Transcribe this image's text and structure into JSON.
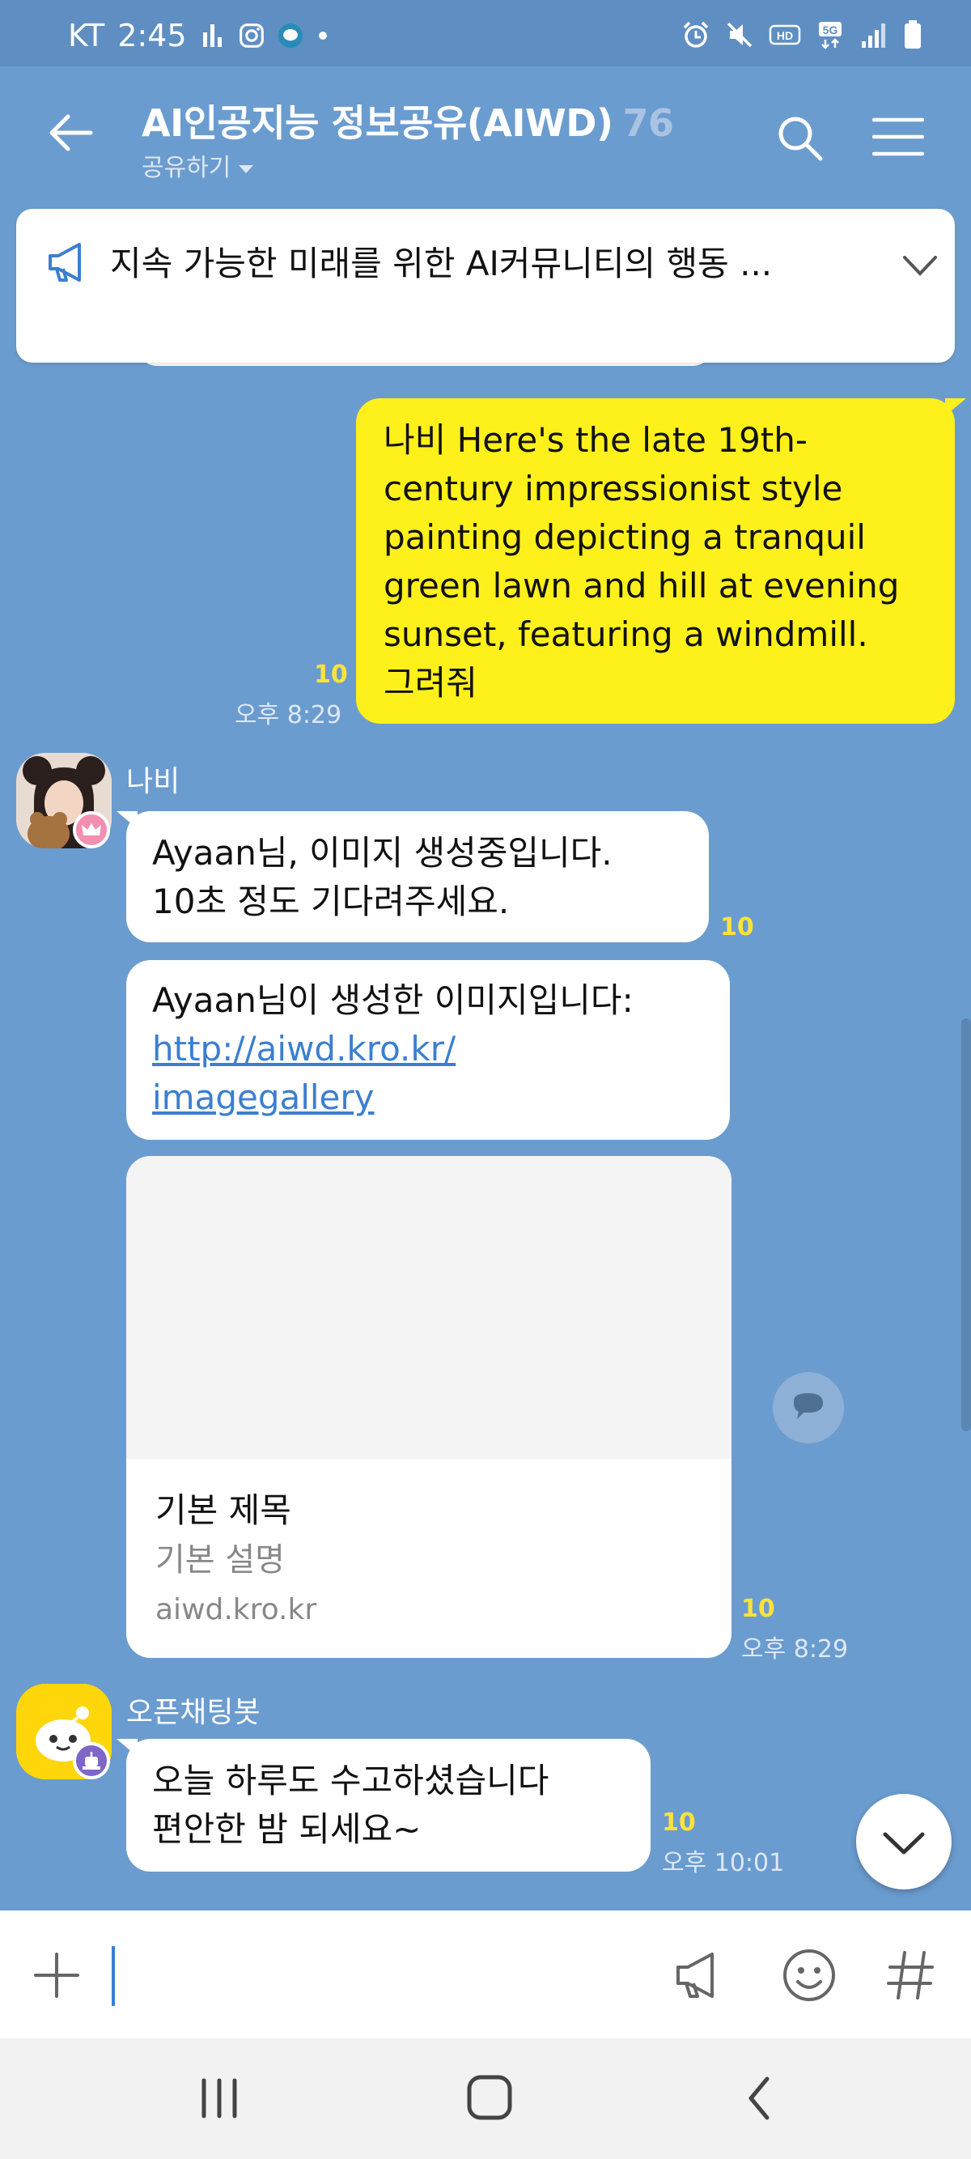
{
  "status_bar": {
    "carrier": "KT",
    "time": "2:45",
    "icons": [
      "signal-bars-icon",
      "instagram-icon",
      "chat-app-icon",
      "dot-icon",
      "alarm-icon",
      "mute-icon",
      "hd-icon",
      "5g-icon",
      "cell-signal-icon",
      "battery-icon"
    ]
  },
  "header": {
    "title": "AI인공지능 정보공유(AIWD)",
    "member_count": "76",
    "subtitle": "공유하기",
    "icons": [
      "back-arrow-icon",
      "search-icon",
      "menu-icon"
    ]
  },
  "notice": {
    "text": "지속 가능한 미래를 위한 AI커뮤니티의 행동 ...",
    "icon": "megaphone-icon"
  },
  "messages": [
    {
      "type": "mine",
      "lines": [
        "나비 Here's the late 19th-",
        "century impressionist style",
        "painting depicting a tranquil",
        "green lawn and hill at evening",
        "sunset, featuring a windmill.",
        "그려줘"
      ],
      "unread": "10",
      "time": "오후 8:29"
    },
    {
      "type": "other",
      "sender": "나비",
      "lines": [
        "Ayaan님, 이미지 생성중입니다.",
        "10초 정도 기다려주세요."
      ],
      "unread": "10"
    },
    {
      "type": "other",
      "text": "Ayaan님이 생성한 이미지입니다:",
      "link_lines": [
        "http://aiwd.kro.kr/",
        "imagegallery"
      ]
    },
    {
      "type": "card",
      "title": "기본 제목",
      "description": "기본 설명",
      "domain": "aiwd.kro.kr",
      "unread": "10",
      "time": "오후 8:29"
    },
    {
      "type": "other",
      "sender": "오픈채팅봇",
      "lines": [
        "오늘 하루도 수고하셨습니다",
        "편안한 밤 되세요~"
      ],
      "unread": "10",
      "time": "오후 10:01"
    }
  ],
  "input_bar": {
    "value": "",
    "icons": [
      "plus-icon",
      "megaphone-icon",
      "emoji-icon",
      "hashtag-icon"
    ]
  },
  "nav_bar": {
    "icons": [
      "recent-apps-icon",
      "home-icon",
      "back-icon"
    ]
  },
  "colors": {
    "chat_background": "#6b9ccf",
    "my_bubble": "#fef01b",
    "other_bubble": "#ffffff",
    "unread_count": "#ffe338",
    "link": "#3b7fd0"
  }
}
